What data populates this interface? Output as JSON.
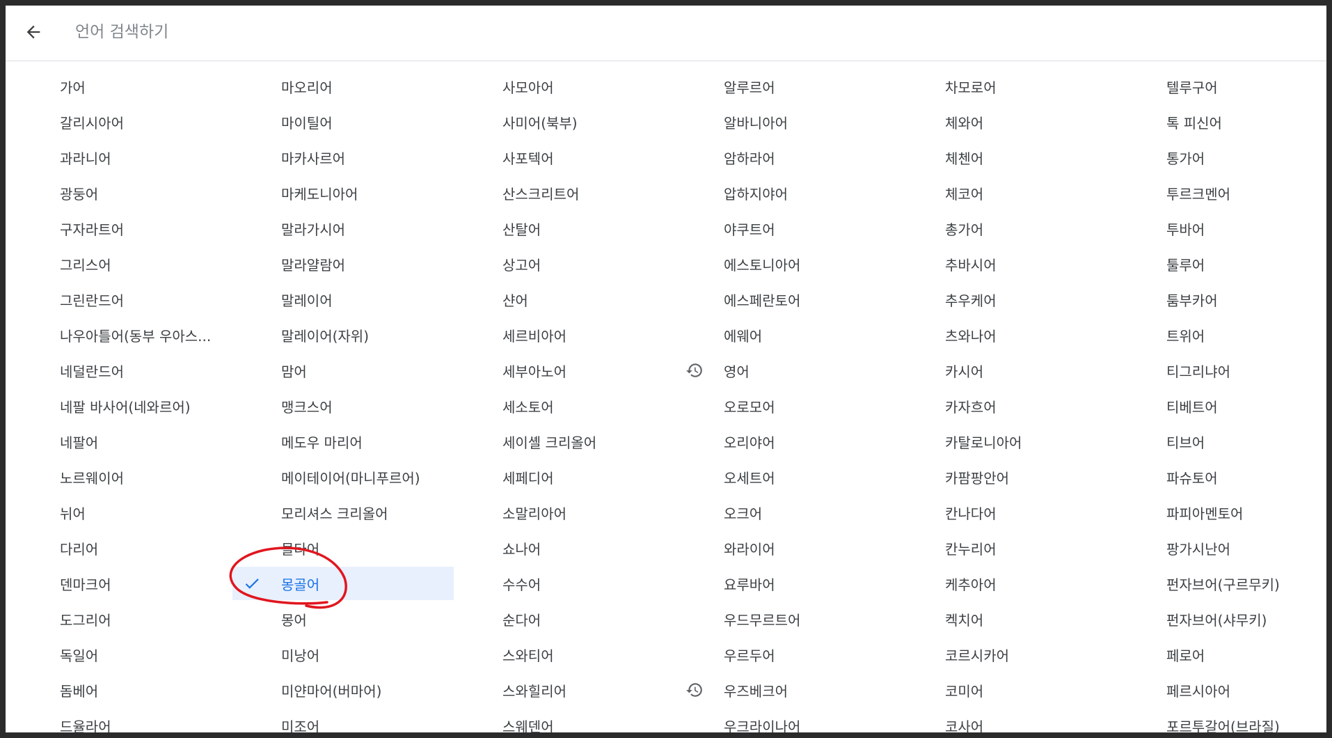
{
  "search": {
    "placeholder": "언어 검색하기"
  },
  "icons": {
    "back": "arrow-left-icon",
    "selected": "check-icon",
    "recent": "history-icon"
  },
  "colors": {
    "selected_bg": "#e8f0fe",
    "selected_text": "#1a73e8",
    "annotation": "#e0161e"
  },
  "columns": [
    {
      "items": [
        {
          "label": "가어"
        },
        {
          "label": "갈리시아어"
        },
        {
          "label": "과라니어"
        },
        {
          "label": "광둥어"
        },
        {
          "label": "구자라트어"
        },
        {
          "label": "그리스어"
        },
        {
          "label": "그린란드어"
        },
        {
          "label": "나우아틀어(동부 우아스..."
        },
        {
          "label": "네덜란드어"
        },
        {
          "label": "네팔 바사어(네와르어)"
        },
        {
          "label": "네팔어"
        },
        {
          "label": "노르웨이어"
        },
        {
          "label": "뉘어"
        },
        {
          "label": "다리어"
        },
        {
          "label": "덴마크어"
        },
        {
          "label": "도그리어"
        },
        {
          "label": "독일어"
        },
        {
          "label": "돔베어"
        },
        {
          "label": "드율라어"
        }
      ]
    },
    {
      "items": [
        {
          "label": "마오리어"
        },
        {
          "label": "마이틸어"
        },
        {
          "label": "마카사르어"
        },
        {
          "label": "마케도니아어"
        },
        {
          "label": "말라가시어"
        },
        {
          "label": "말라얄람어"
        },
        {
          "label": "말레이어"
        },
        {
          "label": "말레이어(자위)"
        },
        {
          "label": "맘어"
        },
        {
          "label": "맹크스어"
        },
        {
          "label": "메도우 마리어"
        },
        {
          "label": "메이테이어(마니푸르어)"
        },
        {
          "label": "모리셔스 크리올어"
        },
        {
          "label": "몰타어"
        },
        {
          "label": "몽골어",
          "selected": true
        },
        {
          "label": "몽어"
        },
        {
          "label": "미낭어"
        },
        {
          "label": "미얀마어(버마어)"
        },
        {
          "label": "미조어"
        }
      ]
    },
    {
      "items": [
        {
          "label": "사모아어"
        },
        {
          "label": "사미어(북부)"
        },
        {
          "label": "사포텍어"
        },
        {
          "label": "산스크리트어"
        },
        {
          "label": "산탈어"
        },
        {
          "label": "상고어"
        },
        {
          "label": "샨어"
        },
        {
          "label": "세르비아어"
        },
        {
          "label": "세부아노어"
        },
        {
          "label": "세소토어"
        },
        {
          "label": "세이셸 크리올어"
        },
        {
          "label": "세페디어"
        },
        {
          "label": "소말리아어"
        },
        {
          "label": "쇼나어"
        },
        {
          "label": "수수어"
        },
        {
          "label": "순다어"
        },
        {
          "label": "스와티어"
        },
        {
          "label": "스와힐리어"
        },
        {
          "label": "스웨덴어"
        }
      ]
    },
    {
      "items": [
        {
          "label": "알루르어"
        },
        {
          "label": "알바니아어"
        },
        {
          "label": "암하라어"
        },
        {
          "label": "압하지야어"
        },
        {
          "label": "야쿠트어"
        },
        {
          "label": "에스토니아어"
        },
        {
          "label": "에스페란토어"
        },
        {
          "label": "에웨어"
        },
        {
          "label": "영어",
          "recent": true
        },
        {
          "label": "오로모어"
        },
        {
          "label": "오리야어"
        },
        {
          "label": "오세트어"
        },
        {
          "label": "오크어"
        },
        {
          "label": "와라이어"
        },
        {
          "label": "요루바어"
        },
        {
          "label": "우드무르트어"
        },
        {
          "label": "우르두어"
        },
        {
          "label": "우즈베크어",
          "recent": true
        },
        {
          "label": "우크라이나어"
        }
      ]
    },
    {
      "items": [
        {
          "label": "차모로어"
        },
        {
          "label": "체와어"
        },
        {
          "label": "체첸어"
        },
        {
          "label": "체코어"
        },
        {
          "label": "총가어"
        },
        {
          "label": "추바시어"
        },
        {
          "label": "추우케어"
        },
        {
          "label": "츠와나어"
        },
        {
          "label": "카시어"
        },
        {
          "label": "카자흐어"
        },
        {
          "label": "카탈로니아어"
        },
        {
          "label": "카팜팡안어"
        },
        {
          "label": "칸나다어"
        },
        {
          "label": "칸누리어"
        },
        {
          "label": "케추아어"
        },
        {
          "label": "켁치어"
        },
        {
          "label": "코르시카어"
        },
        {
          "label": "코미어"
        },
        {
          "label": "코사어"
        }
      ]
    },
    {
      "items": [
        {
          "label": "텔루구어"
        },
        {
          "label": "톡 피신어"
        },
        {
          "label": "통가어"
        },
        {
          "label": "투르크멘어"
        },
        {
          "label": "투바어"
        },
        {
          "label": "툴루어"
        },
        {
          "label": "툼부카어"
        },
        {
          "label": "트위어"
        },
        {
          "label": "티그리냐어"
        },
        {
          "label": "티베트어"
        },
        {
          "label": "티브어"
        },
        {
          "label": "파슈토어"
        },
        {
          "label": "파피아멘토어"
        },
        {
          "label": "팡가시난어"
        },
        {
          "label": "펀자브어(구르무키)"
        },
        {
          "label": "펀자브어(샤무키)"
        },
        {
          "label": "페로어"
        },
        {
          "label": "페르시아어"
        },
        {
          "label": "포르투갈어(브라질)"
        }
      ]
    }
  ]
}
